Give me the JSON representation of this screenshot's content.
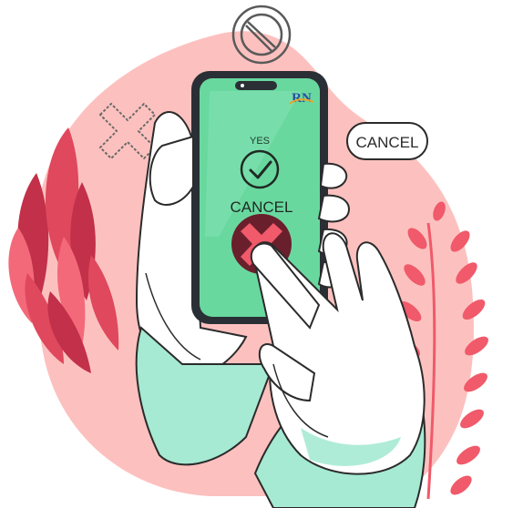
{
  "colors": {
    "blob": "#fcc1bf",
    "leaf_dark": "#c23049",
    "leaf_mid": "#e0485d",
    "leaf_light": "#f3697a",
    "phone_body": "#2a2f36",
    "screen": "#69d89f",
    "hand_fill": "#ffffff",
    "hand_shadow": "#a6ead3",
    "outline": "#2b2b2b",
    "cancel_circle": "#6a1f2c",
    "cancel_x": "#f05a6a"
  },
  "logo_text": "RN",
  "phone": {
    "yes_label": "YES",
    "cancel_label": "CANCEL"
  },
  "floating_pill": {
    "label": "CANCEL"
  },
  "icons": [
    "prohibited-icon",
    "x-outline-icon",
    "check-icon",
    "cancel-x-icon"
  ]
}
